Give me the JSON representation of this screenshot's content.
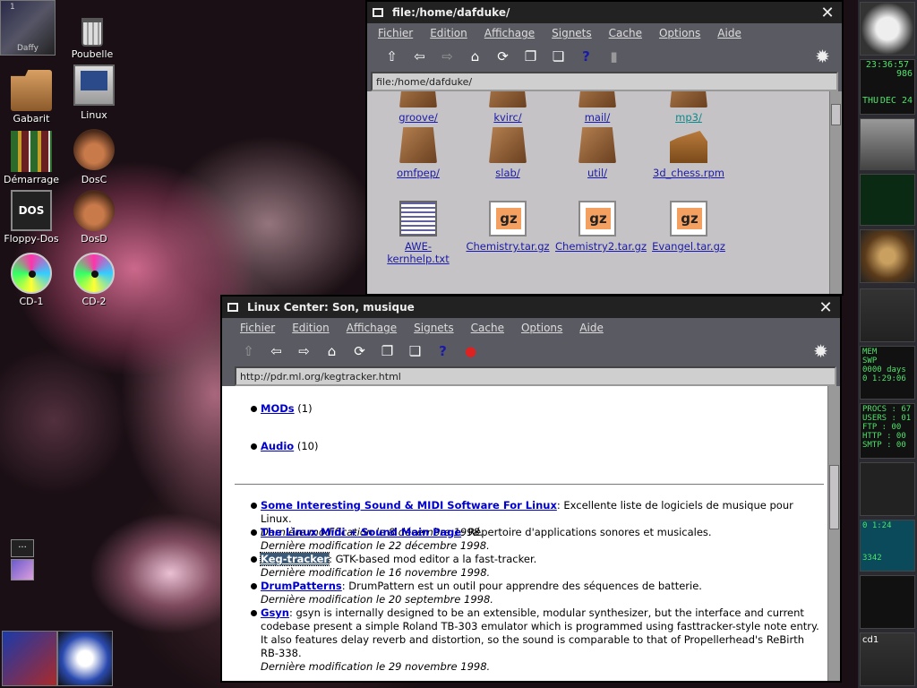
{
  "desktop": {
    "daffy": {
      "label": "Daffy",
      "num": "1"
    },
    "icons": [
      {
        "label": "Poubelle",
        "icon": "trash-icon"
      },
      {
        "label": "Gabarit",
        "icon": "folder-icon"
      },
      {
        "label": "Linux",
        "icon": "computer-icon"
      },
      {
        "label": "Démarrage",
        "icon": "books-icon"
      },
      {
        "label": "DosC",
        "icon": "drive-icon"
      },
      {
        "label": "Floppy-Dos",
        "icon": "floppy-icon"
      },
      {
        "label": "DosD",
        "icon": "drive-icon"
      },
      {
        "label": "CD-1",
        "icon": "cd-icon"
      },
      {
        "label": "CD-2",
        "icon": "cd-icon"
      }
    ],
    "floppy_text": "DOS",
    "mini_label": "..."
  },
  "window1": {
    "title": "file:/home/dafduke/",
    "menu": [
      "Fichier",
      "Edition",
      "Affichage",
      "Signets",
      "Cache",
      "Options",
      "Aide"
    ],
    "url": "file:/home/dafduke/",
    "files_row0": [
      "groove/",
      "kvirc/",
      "mail/",
      "mp3/"
    ],
    "files_row1": [
      "omfpep/",
      "slab/",
      "util/",
      "3d_chess.rpm"
    ],
    "files_row2": [
      "AWE-kernhelp.txt",
      "Chemistry.tar.gz",
      "Chemistry2.tar.gz",
      "Evangel.tar.gz"
    ]
  },
  "window2": {
    "title": "Linux Center: Son, musique",
    "menu": [
      "Fichier",
      "Edition",
      "Affichage",
      "Signets",
      "Cache",
      "Options",
      "Aide"
    ],
    "url": "http://pdr.ml.org/kegtracker.html",
    "top_items": [
      {
        "link": "MODs",
        "count": "(1)"
      },
      {
        "link": "Audio",
        "count": "(10)"
      }
    ],
    "entries": [
      {
        "link": "Some Interesting Sound & MIDI Software For Linux",
        "text": ": Excellente liste de logiciels de musique pour Linux.",
        "date": "Dernière modification le 8 décembre 1998."
      },
      {
        "link": "The Linux Midi + Sound Main Page",
        "text": ": Répertoire d'applications sonores et musicales.",
        "date": "Dernière modification le 22 décembre 1998."
      },
      {
        "link": "Keg-tracker",
        "text": ": GTK-based mod editor a la fast-tracker.",
        "date": "Dernière modification le 16 novembre 1998."
      },
      {
        "link": "DrumPatterns",
        "text": ": DrumPattern est un outil pour apprendre des séquences de batterie.",
        "date": "Dernière modification le 20 septembre 1998."
      },
      {
        "link": "Gsyn",
        "text": ": gsyn is internally designed to be an extensible, modular synthesizer, but the interface and current codebase present a simple Roland TB-303 emulator which is programmed using fasttracker-style note entry. It also features delay reverb and distortion, so the sound is comparable to that of Propellerhead's ReBirth RB-338.",
        "date": "Dernière modification le 29 novembre 1998."
      }
    ]
  },
  "dock": {
    "time": "23:36:57",
    "num": "986",
    "day": "THU",
    "date": "DEC 24",
    "mem": "MEM",
    "swp": "SWP",
    "days": "0000 days",
    "uptime": "0 1:29:06",
    "procs": "PROCS : 67",
    "users": "USERS : 01",
    "ftp": "FTP : 00",
    "http": "HTTP : 00",
    "smtp": "SMTP : 00",
    "counter1": "0 1:24",
    "counter2": "3342",
    "cd": "cd1"
  }
}
